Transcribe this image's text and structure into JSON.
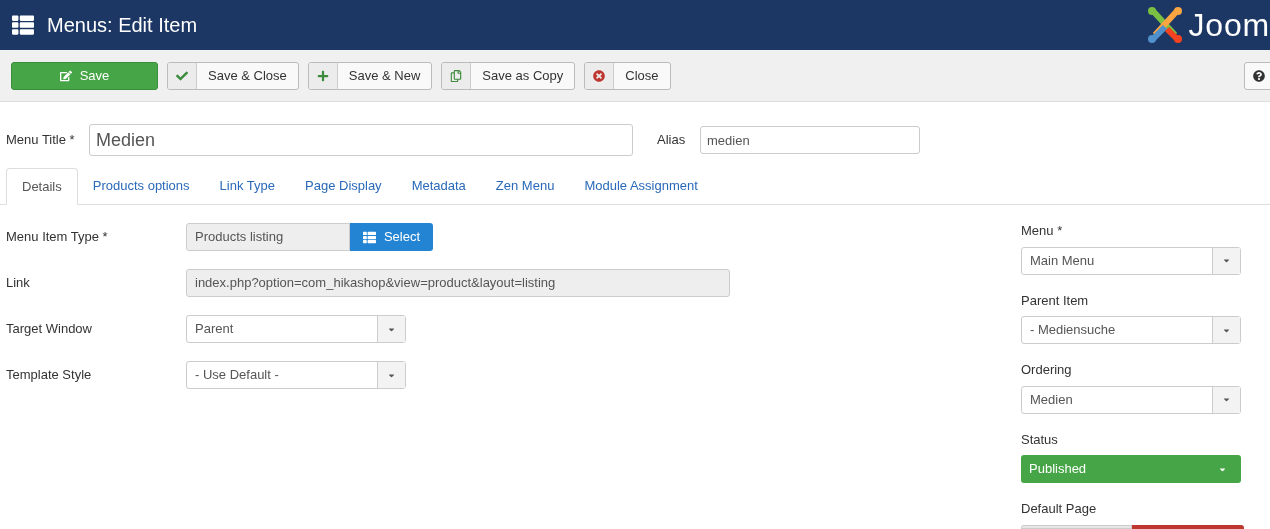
{
  "header": {
    "title": "Menus: Edit Item",
    "logo_text": "Joom"
  },
  "toolbar": [
    {
      "kind": "primary",
      "label": "Save"
    },
    {
      "kind": "icon",
      "label": "Save & Close"
    },
    {
      "kind": "icon",
      "label": "Save & New"
    },
    {
      "kind": "icon",
      "label": "Save as Copy"
    },
    {
      "kind": "icon",
      "label": "Close"
    }
  ],
  "title_field": {
    "label": "Menu Title *",
    "value": "Medien"
  },
  "alias_field": {
    "label": "Alias",
    "value": "medien"
  },
  "tabs": [
    {
      "label": "Details",
      "selected": true
    },
    {
      "label": "Products options",
      "selected": false
    },
    {
      "label": "Link Type",
      "selected": false
    },
    {
      "label": "Page Display",
      "selected": false
    },
    {
      "label": "Metadata",
      "selected": false
    },
    {
      "label": "Zen Menu",
      "selected": false
    },
    {
      "label": "Module Assignment",
      "selected": false
    }
  ],
  "fields": [
    {
      "kind": "picker",
      "label": "Menu Item Type *",
      "value": "Products listing",
      "button": "Select"
    },
    {
      "kind": "readonly",
      "label": "Link",
      "value": "index.php?option=com_hikashop&view=product&layout=listing"
    },
    {
      "kind": "select",
      "label": "Target Window",
      "value": "Parent"
    },
    {
      "kind": "select",
      "label": "Template Style",
      "value": "- Use Default -"
    }
  ],
  "side_fields": [
    {
      "label": "Menu *",
      "value": "Main Menu",
      "kind": "select"
    },
    {
      "label": "Parent Item",
      "value": "- Mediensuche",
      "kind": "select"
    },
    {
      "label": "Ordering",
      "value": "Medien",
      "kind": "select"
    },
    {
      "label": "Status",
      "value": "Published",
      "kind": "status"
    },
    {
      "label": "Default Page",
      "kind": "toggle",
      "on": false
    }
  ]
}
